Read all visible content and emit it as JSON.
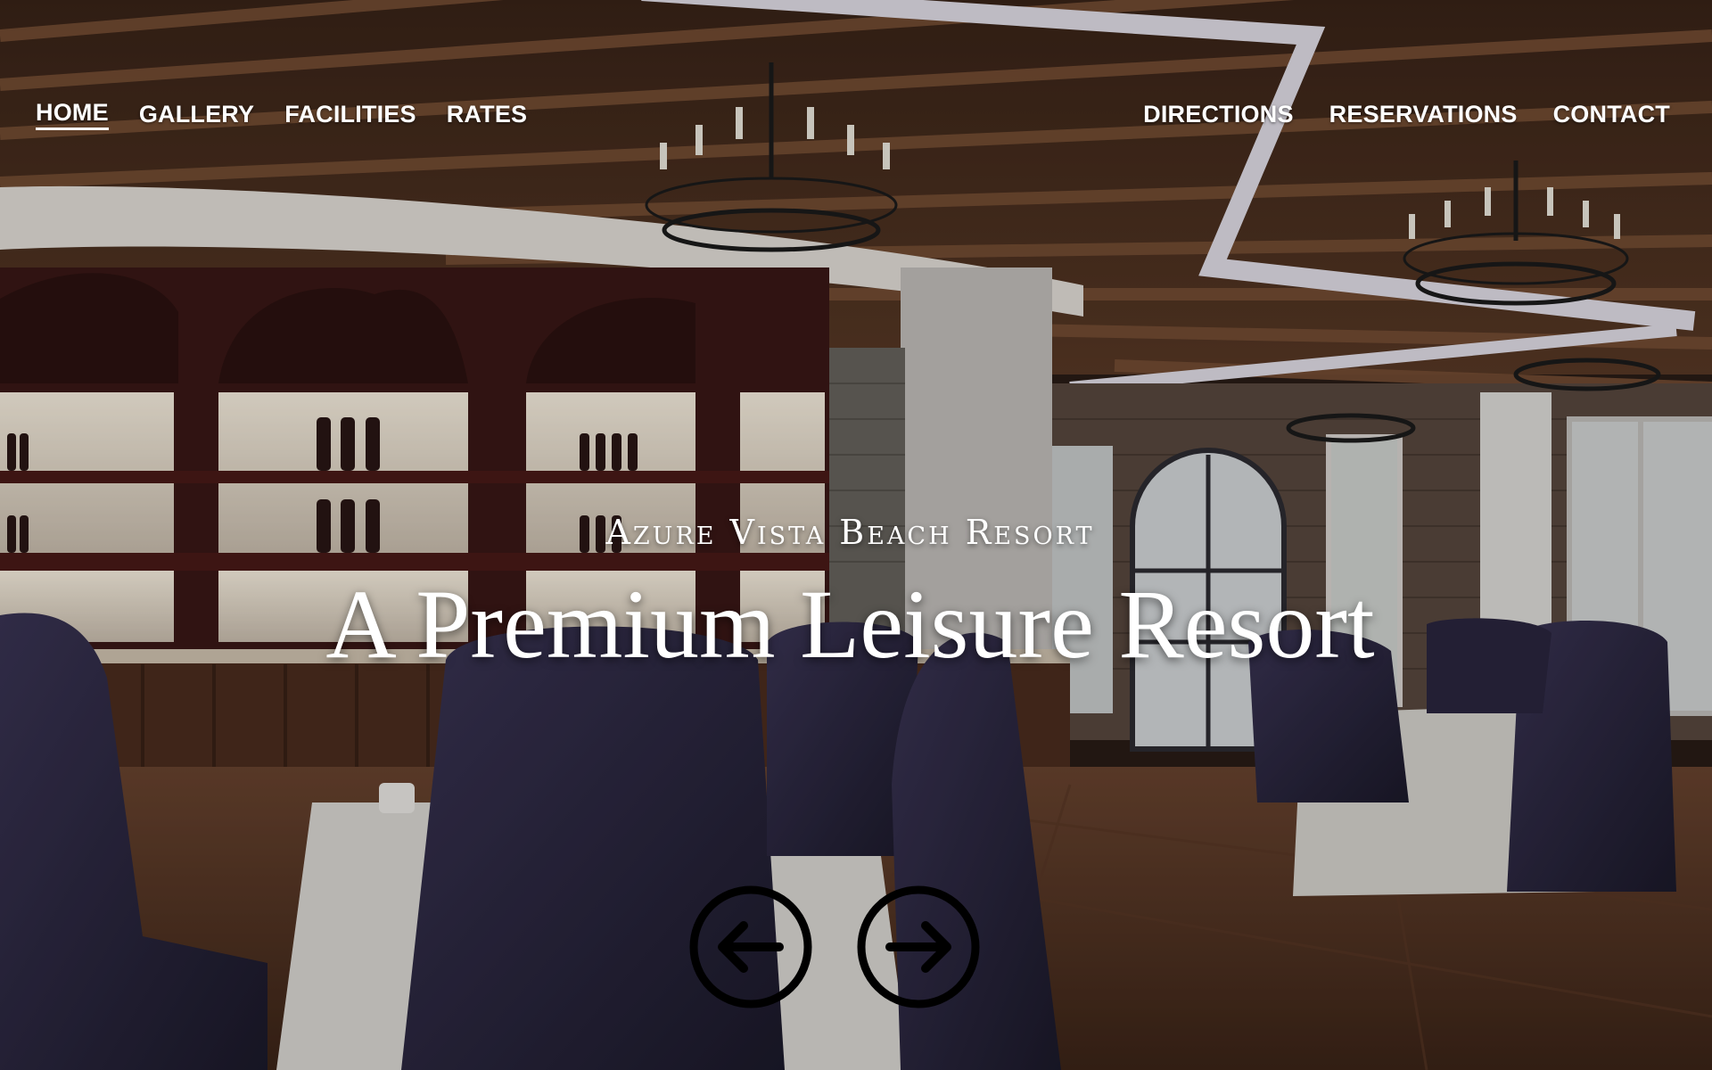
{
  "nav": {
    "left": [
      {
        "label": "HOME",
        "active": true
      },
      {
        "label": "GALLERY"
      },
      {
        "label": "FACILITIES"
      },
      {
        "label": "RATES"
      }
    ],
    "right": [
      {
        "label": "DIRECTIONS"
      },
      {
        "label": "RESERVATIONS"
      },
      {
        "label": "CONTACT"
      }
    ]
  },
  "hero": {
    "kicker": "Azure Vista Beach Resort",
    "headline": "A Premium Leisure Resort",
    "prev_icon": "arrow-left-circle-icon",
    "next_icon": "arrow-right-circle-icon"
  },
  "colors": {
    "nav_text": "#ffffff",
    "hero_text": "#ffffff",
    "arrow_stroke": "#000000"
  }
}
